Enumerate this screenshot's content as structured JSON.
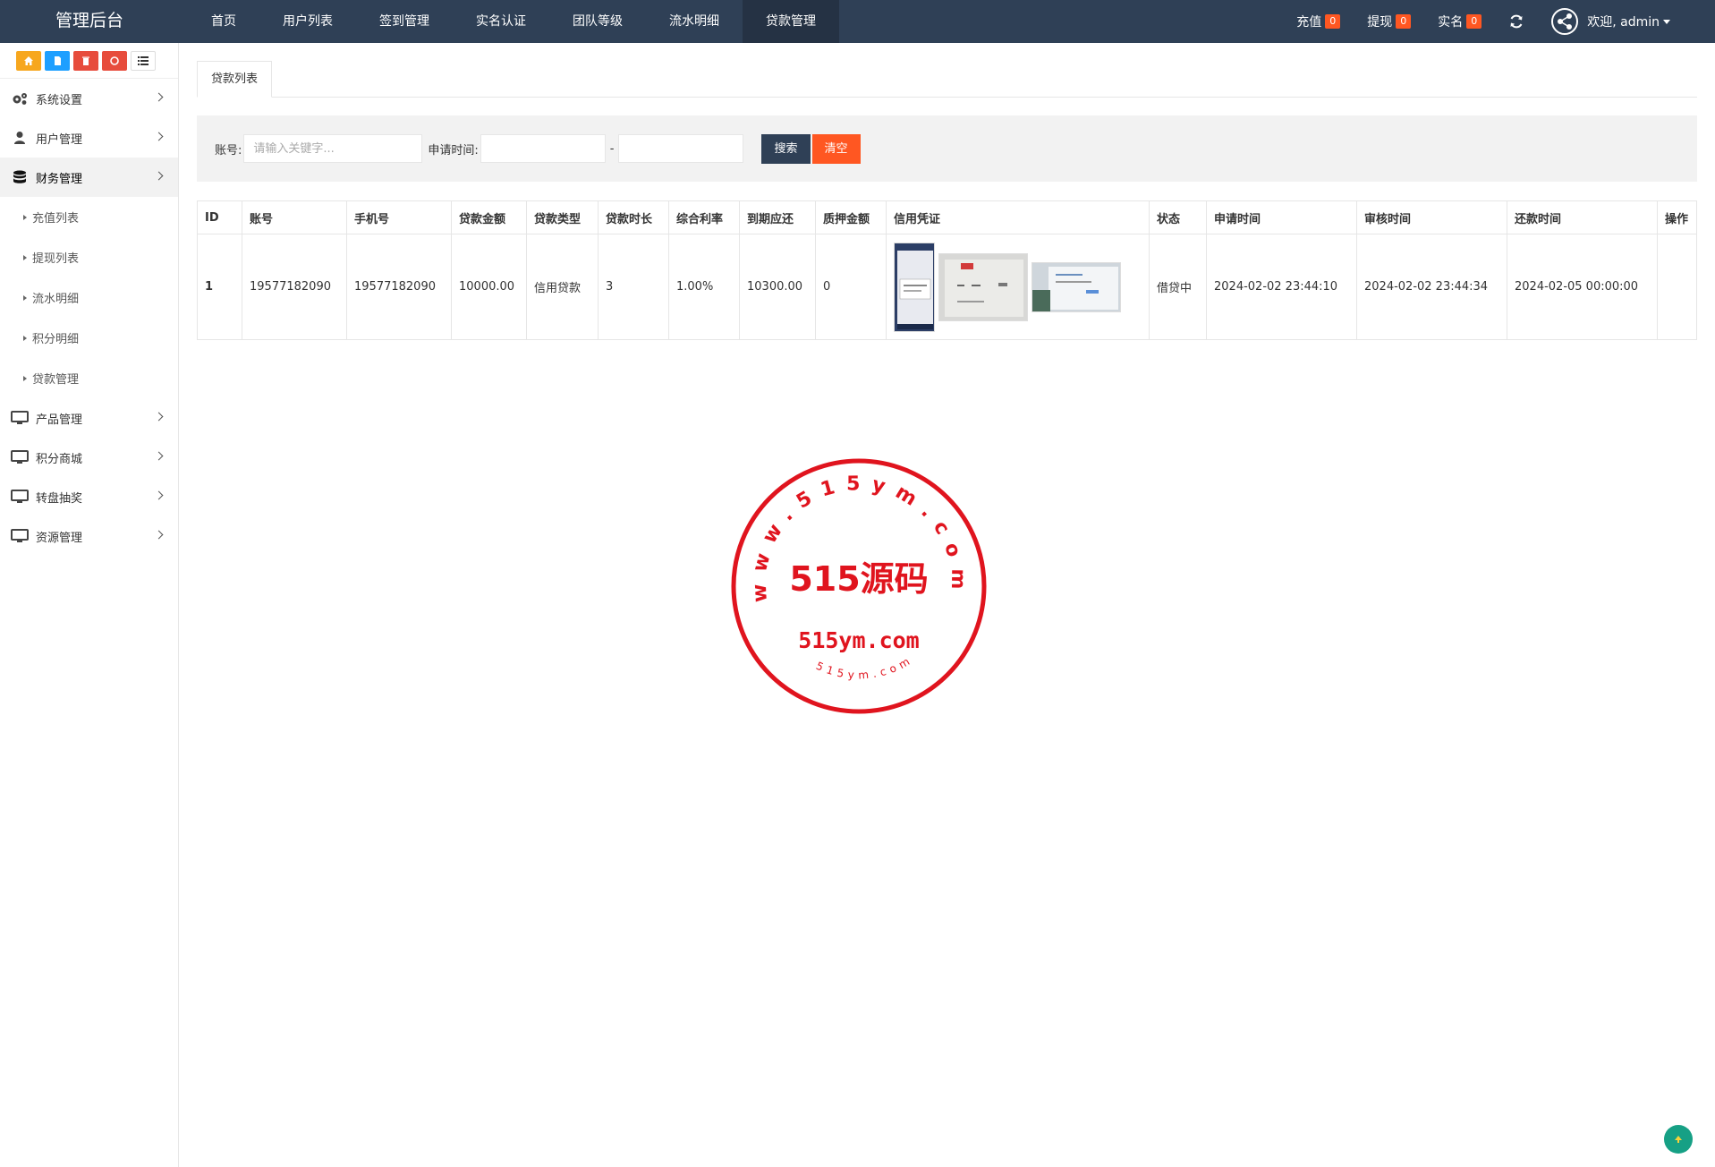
{
  "app": {
    "title": "管理后台"
  },
  "topnav": [
    {
      "label": "首页",
      "active": false
    },
    {
      "label": "用户列表",
      "active": false
    },
    {
      "label": "签到管理",
      "active": false
    },
    {
      "label": "实名认证",
      "active": false
    },
    {
      "label": "团队等级",
      "active": false
    },
    {
      "label": "流水明细",
      "active": false
    },
    {
      "label": "贷款管理",
      "active": true
    }
  ],
  "topright": {
    "recharge": {
      "label": "充值",
      "count": "0"
    },
    "withdraw": {
      "label": "提现",
      "count": "0"
    },
    "realname": {
      "label": "实名",
      "count": "0"
    },
    "welcome": "欢迎, admin"
  },
  "sidebar": {
    "items": [
      {
        "label": "系统设置",
        "icon": "gears-icon"
      },
      {
        "label": "用户管理",
        "icon": "user-icon"
      },
      {
        "label": "财务管理",
        "icon": "database-icon",
        "active": true
      }
    ],
    "subitems": [
      {
        "label": "充值列表"
      },
      {
        "label": "提现列表"
      },
      {
        "label": "流水明细"
      },
      {
        "label": "积分明细"
      },
      {
        "label": "贷款管理"
      }
    ],
    "items2": [
      {
        "label": "产品管理",
        "icon": "monitor-icon"
      },
      {
        "label": "积分商城",
        "icon": "monitor-icon"
      },
      {
        "label": "转盘抽奖",
        "icon": "monitor-icon"
      },
      {
        "label": "资源管理",
        "icon": "monitor-icon"
      }
    ]
  },
  "tab": {
    "label": "贷款列表"
  },
  "search": {
    "account_label": "账号:",
    "account_placeholder": "请输入关键字...",
    "time_label": "申请时间:",
    "dash": "-",
    "search_btn": "搜索",
    "clear_btn": "清空"
  },
  "table": {
    "headers": [
      "ID",
      "账号",
      "手机号",
      "贷款金额",
      "贷款类型",
      "贷款时长",
      "综合利率",
      "到期应还",
      "质押金额",
      "信用凭证",
      "状态",
      "申请时间",
      "审核时间",
      "还款时间",
      "操作"
    ],
    "rows": [
      {
        "id": "1",
        "account": "19577182090",
        "phone": "19577182090",
        "amount": "10000.00",
        "type": "信用贷款",
        "duration": "3",
        "rate": "1.00%",
        "due": "10300.00",
        "pledge": "0",
        "status": "借贷中",
        "apply_time": "2024-02-02 23:44:10",
        "audit_time": "2024-02-02 23:44:34",
        "repay_time": "2024-02-05 00:00:00"
      }
    ]
  },
  "watermark": {
    "main": "515源码",
    "domain": "515ym.com",
    "ring_top": "www.515ym.com",
    "ring_bottom": "515ym.com",
    "color": "#e0141e"
  },
  "colors": {
    "topbar": "#2f4056",
    "accent": "#ff5722",
    "active_nav": "#253244"
  }
}
